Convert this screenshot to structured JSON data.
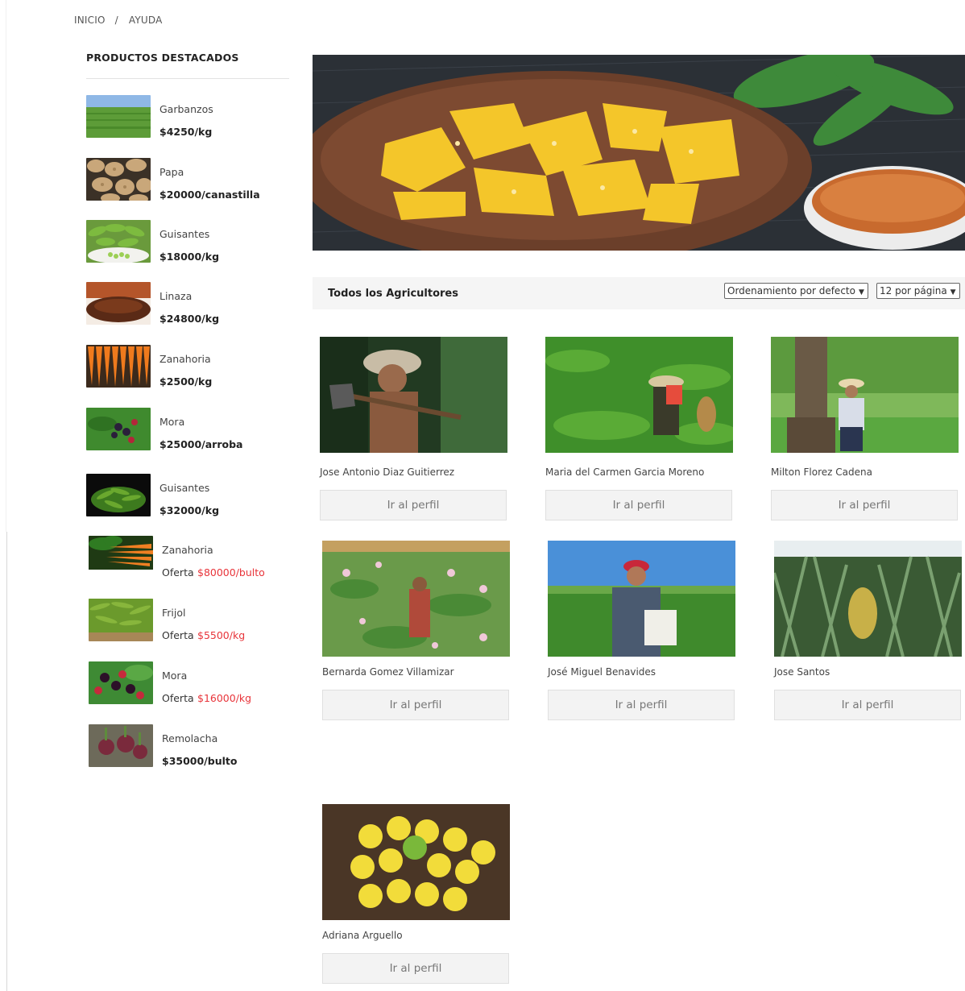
{
  "breadcrumb": {
    "home": "INICIO",
    "separator": "/",
    "current": "AYUDA"
  },
  "sidebar": {
    "title": "PRODUCTOS DESTACADOS",
    "products": [
      {
        "name": "Garbanzos",
        "price": "$4250/kg"
      },
      {
        "name": "Papa",
        "price": "$20000/canastilla"
      },
      {
        "name": "Guisantes",
        "price": "$18000/kg"
      },
      {
        "name": "Linaza",
        "price": "$24800/kg"
      },
      {
        "name": "Zanahoria",
        "price": "$2500/kg"
      },
      {
        "name": "Mora",
        "price": "$25000/arroba"
      },
      {
        "name": "Guisantes",
        "price": "$32000/kg"
      },
      {
        "name": "Zanahoria",
        "offer_label": "Oferta",
        "price": "$80000/bulto"
      },
      {
        "name": "Frijol",
        "offer_label": "Oferta",
        "price": "$5500/kg"
      },
      {
        "name": "Mora",
        "offer_label": "Oferta",
        "price": "$16000/kg"
      },
      {
        "name": "Remolacha",
        "price": "$35000/bulto"
      }
    ]
  },
  "toolbar": {
    "title": "Todos los Agricultores",
    "sort_select": "Ordenamiento por defecto",
    "per_page_select": "12 por página"
  },
  "farmers": [
    {
      "name": "Jose Antonio Diaz Guitierrez",
      "button": "Ir al perfil"
    },
    {
      "name": "Maria del Carmen Garcia Moreno",
      "button": "Ir al perfil"
    },
    {
      "name": "Milton Florez Cadena",
      "button": "Ir al perfil"
    },
    {
      "name": "Bernarda Gomez Villamizar",
      "button": "Ir al perfil"
    },
    {
      "name": "José Miguel Benavides",
      "button": "Ir al perfil"
    },
    {
      "name": "Jose Santos",
      "button": "Ir al perfil"
    },
    {
      "name": "Adriana Arguello",
      "button": "Ir al perfil"
    }
  ],
  "colors": {
    "offer_price": "#e8343a",
    "toolbar_bg": "#f5f5f5",
    "button_bg": "#f3f3f3"
  }
}
